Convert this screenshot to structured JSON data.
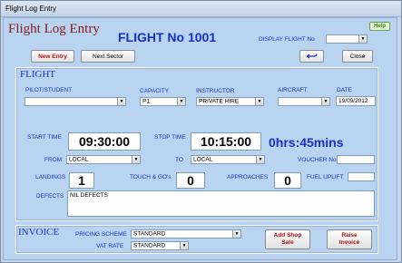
{
  "window": {
    "title": "Flight Log Entry"
  },
  "header": {
    "form_title": "Flight Log Entry",
    "flight_number": "FLIGHT No 1001",
    "help_label": "Help",
    "display_flight_label": "DISPLAY FLIGHT No",
    "display_flight_value": ""
  },
  "toolbar": {
    "new_entry": "New Entry",
    "next_sector": "Next Sector",
    "undo_icon": "undo-arrow-icon",
    "close": "Close"
  },
  "flight": {
    "section_title": "FLIGHT",
    "pilot_label": "PILOT/STUDENT",
    "pilot_value": "",
    "capacity_label": "CAPACITY",
    "capacity_value": "P1",
    "instructor_label": "INSTRUCTOR",
    "instructor_value": "PRIVATE HIRE",
    "aircraft_label": "AIRCRAFT",
    "aircraft_value": "",
    "date_label": "DATE",
    "date_value": "19/09/2012",
    "start_time_label": "START TIME",
    "start_time_value": "09:30:00",
    "stop_time_label": "STOP TIME",
    "stop_time_value": "10:15:00",
    "duration": "0hrs:45mins",
    "from_label": "FROM",
    "from_value": "LOCAL",
    "to_label": "TO",
    "to_value": "LOCAL",
    "voucher_label": "VOUCHER No.",
    "voucher_value": "",
    "landings_label": "LANDINGS",
    "landings_value": "1",
    "touch_go_label": "TOUCH & GO's",
    "touch_go_value": "0",
    "approaches_label": "APPROACHES",
    "approaches_value": "0",
    "fuel_uplift_label": "FUEL UPLIFT",
    "fuel_uplift_value": "",
    "defects_label": "DEFECTS",
    "defects_value": "NIL DEFECTS"
  },
  "invoice": {
    "section_title": "INVOICE",
    "pricing_label": "PRICING SCHEME",
    "pricing_value": "STANDARD",
    "vat_label": "VAT RATE",
    "vat_value": "STANDARD",
    "add_shop_sale": "Add Shop Sale",
    "raise_invoice": "Raise Invoice"
  },
  "colors": {
    "accent_blue": "#1a2ecc",
    "title_red": "#8b1a1a",
    "background": "#b9d4f0"
  }
}
